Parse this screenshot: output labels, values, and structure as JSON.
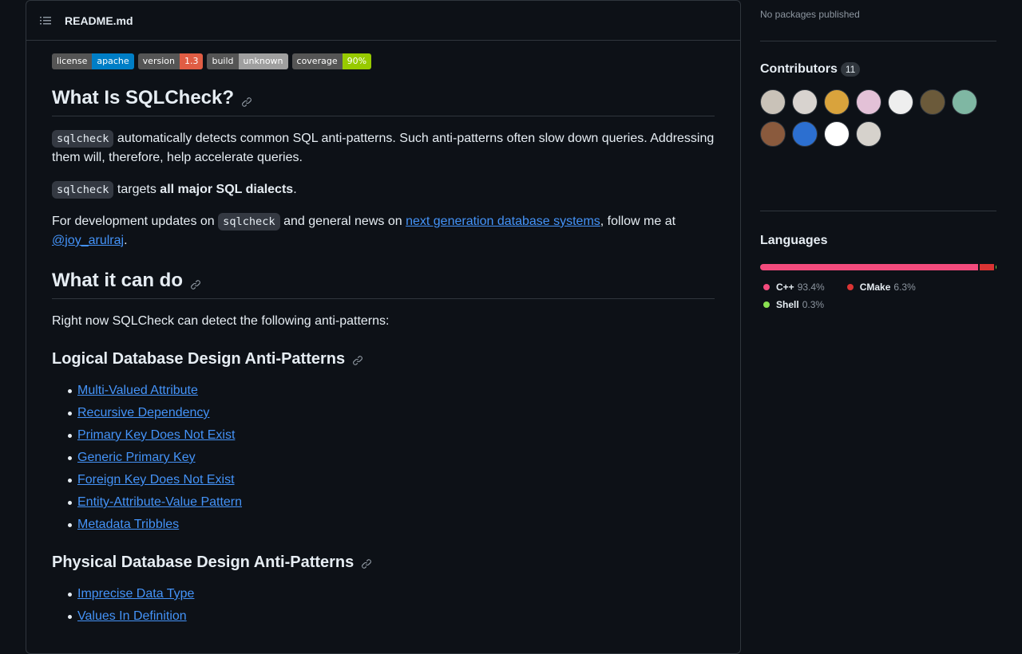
{
  "readme": {
    "title": "README.md",
    "badges": [
      {
        "label": "license",
        "value": "apache",
        "color": "#007ec6"
      },
      {
        "label": "version",
        "value": "1.3",
        "color": "#e05d44"
      },
      {
        "label": "build",
        "value": "unknown",
        "color": "#9f9f9f"
      },
      {
        "label": "coverage",
        "value": "90%",
        "color": "#97ca00"
      }
    ],
    "h1_what_is": "What Is SQLCheck?",
    "code_sqlcheck": "sqlcheck",
    "p1_text": " automatically detects common SQL anti-patterns. Such anti-patterns often slow down queries. Addressing them will, therefore, help accelerate queries.",
    "p2_text": " targets ",
    "p2_bold": "all major SQL dialects",
    "p2_end": ".",
    "p3_a": "For development updates on ",
    "p3_b": " and general news on ",
    "p3_link": "next generation database systems",
    "p3_c": ", follow me at ",
    "p3_handle": "@joy_arulraj",
    "p3_end": ".",
    "h1_what_can": "What it can do",
    "p4": "Right now SQLCheck can detect the following anti-patterns:",
    "h2_logical": "Logical Database Design Anti-Patterns",
    "logical_items": [
      "Multi-Valued Attribute",
      "Recursive Dependency",
      "Primary Key Does Not Exist",
      "Generic Primary Key",
      "Foreign Key Does Not Exist",
      "Entity-Attribute-Value Pattern",
      "Metadata Tribbles"
    ],
    "h2_physical": "Physical Database Design Anti-Patterns",
    "physical_items": [
      "Imprecise Data Type",
      "Values In Definition"
    ]
  },
  "sidebar": {
    "packages_text": "No packages published",
    "contributors_title": "Contributors",
    "contributors_count": "11",
    "avatar_colors": [
      "#c9c2b8",
      "#d8d3cf",
      "#d9a33c",
      "#e3c1d7",
      "#eeeeee",
      "#6b5a3a",
      "#7fb7a3",
      "#8a5a3d",
      "#2c6fd0",
      "#ffffff",
      "#d6d2cc"
    ],
    "languages_title": "Languages",
    "languages": [
      {
        "name": "C++",
        "pct": "93.4%",
        "value": 93.4,
        "color": "#f34b7d"
      },
      {
        "name": "CMake",
        "pct": "6.3%",
        "value": 6.3,
        "color": "#da3434"
      },
      {
        "name": "Shell",
        "pct": "0.3%",
        "value": 0.3,
        "color": "#89e051"
      }
    ]
  }
}
